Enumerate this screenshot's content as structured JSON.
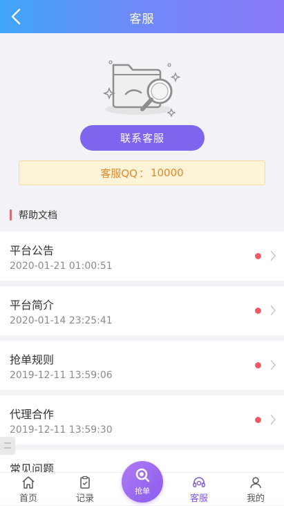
{
  "header": {
    "title": "客服",
    "back_icon": "chevron-left-icon"
  },
  "illustration": {
    "icon": "empty-folder-magnifier-icon"
  },
  "contact_button": {
    "label": "联系客服"
  },
  "qq": {
    "label": "客服QQ",
    "separator": "：",
    "value": "10000"
  },
  "help_section": {
    "title": "帮助文档",
    "items": [
      {
        "title": "平台公告",
        "date": "2020-01-21 01:00:51"
      },
      {
        "title": "平台简介",
        "date": "2020-01-14 23:25:41"
      },
      {
        "title": "抢单规则",
        "date": "2019-12-11 13:59:06"
      },
      {
        "title": "代理合作",
        "date": "2019-12-11 13:59:30"
      },
      {
        "title": "常见问题",
        "date": ""
      }
    ]
  },
  "tabbar": {
    "home": {
      "label": "首页",
      "icon": "home-icon"
    },
    "records": {
      "label": "记录",
      "icon": "clipboard-icon"
    },
    "grab": {
      "label": "抢单",
      "icon": "magnifier-icon"
    },
    "service": {
      "label": "客服",
      "icon": "headset-icon"
    },
    "mine": {
      "label": "我的",
      "icon": "user-icon"
    }
  },
  "colors": {
    "header_gradient_start": "#3ea6f7",
    "header_gradient_end": "#8a78f6",
    "accent": "#7f64ee",
    "dot": "#ee5a66",
    "qq_text": "#e48a2c",
    "active_tab": "#7e57e6"
  }
}
